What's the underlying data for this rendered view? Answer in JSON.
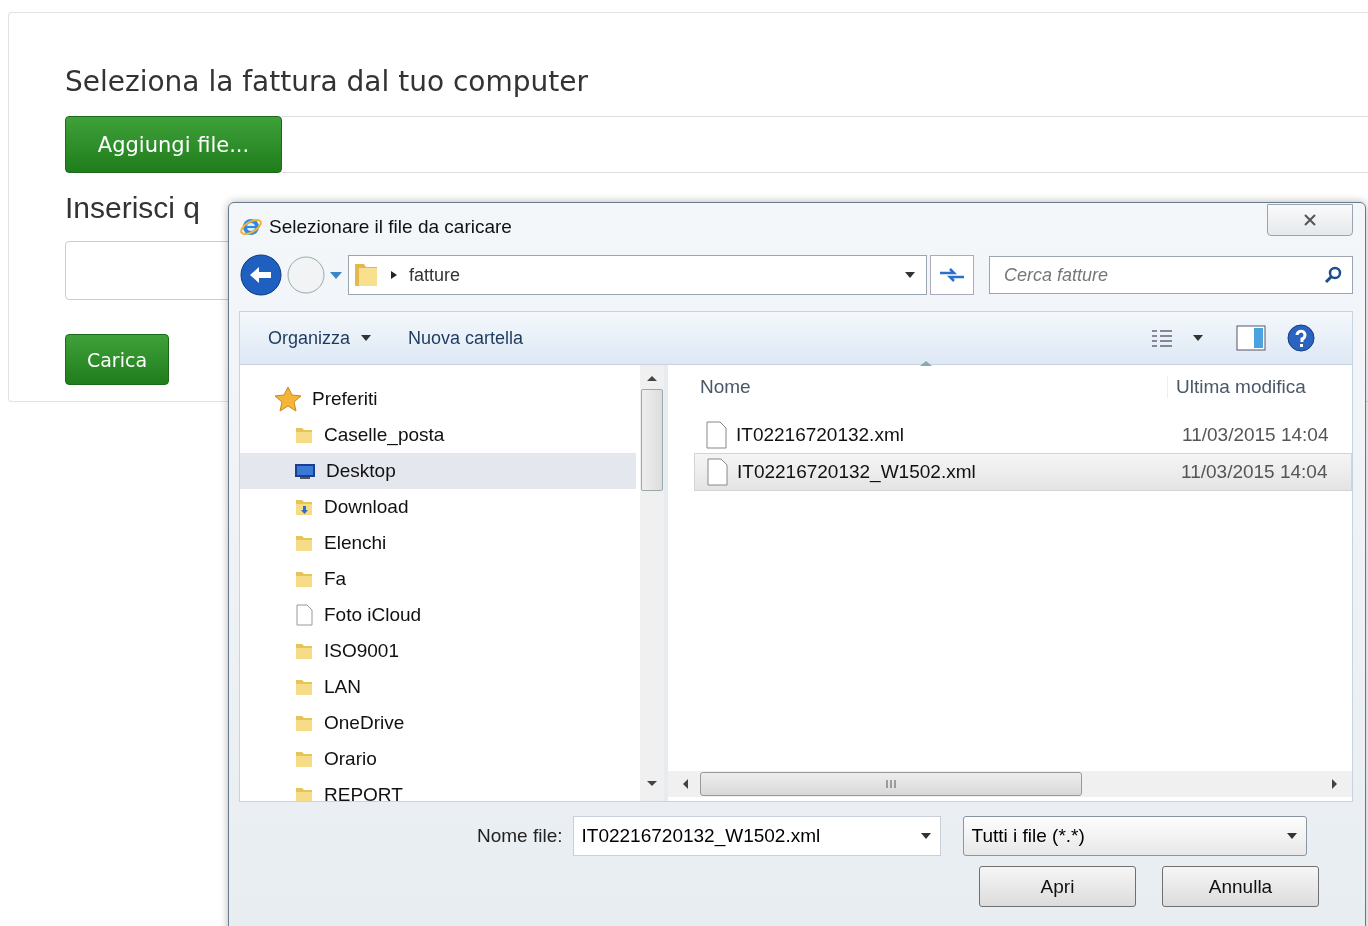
{
  "page": {
    "title": "Seleziona la fattura dal tuo computer",
    "add_button": "Aggiungi file...",
    "label_2": "Inserisci q",
    "submit_button": "Carica"
  },
  "dialog": {
    "title": "Selezionare il file da caricare",
    "path": [
      "fatture"
    ],
    "search": {
      "placeholder": "Cerca fatture"
    },
    "toolbar": [
      {
        "label": "Organizza",
        "menu": true
      },
      {
        "label": "Nuova cartella",
        "menu": false
      }
    ],
    "nav": {
      "label": "Preferiti",
      "expanded": true,
      "children": [
        {
          "label": "Caselle_posta",
          "kind": "folder",
          "selected": false
        },
        {
          "label": "Desktop",
          "kind": "desktop",
          "selected": true
        },
        {
          "label": "Download",
          "kind": "download",
          "selected": false
        },
        {
          "label": "Elenchi",
          "kind": "folder",
          "selected": false
        },
        {
          "label": "Fa",
          "kind": "folder",
          "selected": false
        },
        {
          "label": "Foto iCloud",
          "kind": "file",
          "selected": false
        },
        {
          "label": "ISO9001",
          "kind": "folder",
          "selected": false
        },
        {
          "label": "LAN",
          "kind": "folder",
          "selected": false
        },
        {
          "label": "OneDrive",
          "kind": "folder",
          "selected": false
        },
        {
          "label": "Orario",
          "kind": "folder",
          "selected": false
        },
        {
          "label": "REPORT",
          "kind": "folder",
          "selected": false
        }
      ]
    },
    "columns": [
      "Nome",
      "Ultima modifica"
    ],
    "files": [
      {
        "name": "IT02216720132.xml",
        "modified": "11/03/2015 14:04",
        "selected": false
      },
      {
        "name": "IT02216720132_W1502.xml",
        "modified": "11/03/2015 14:04",
        "selected": true
      }
    ],
    "filename_label": "Nome file:",
    "filename": "IT02216720132_W1502.xml",
    "filter": "Tutti i file (*.*)",
    "buttons": [
      "Apri",
      "Annulla"
    ]
  }
}
